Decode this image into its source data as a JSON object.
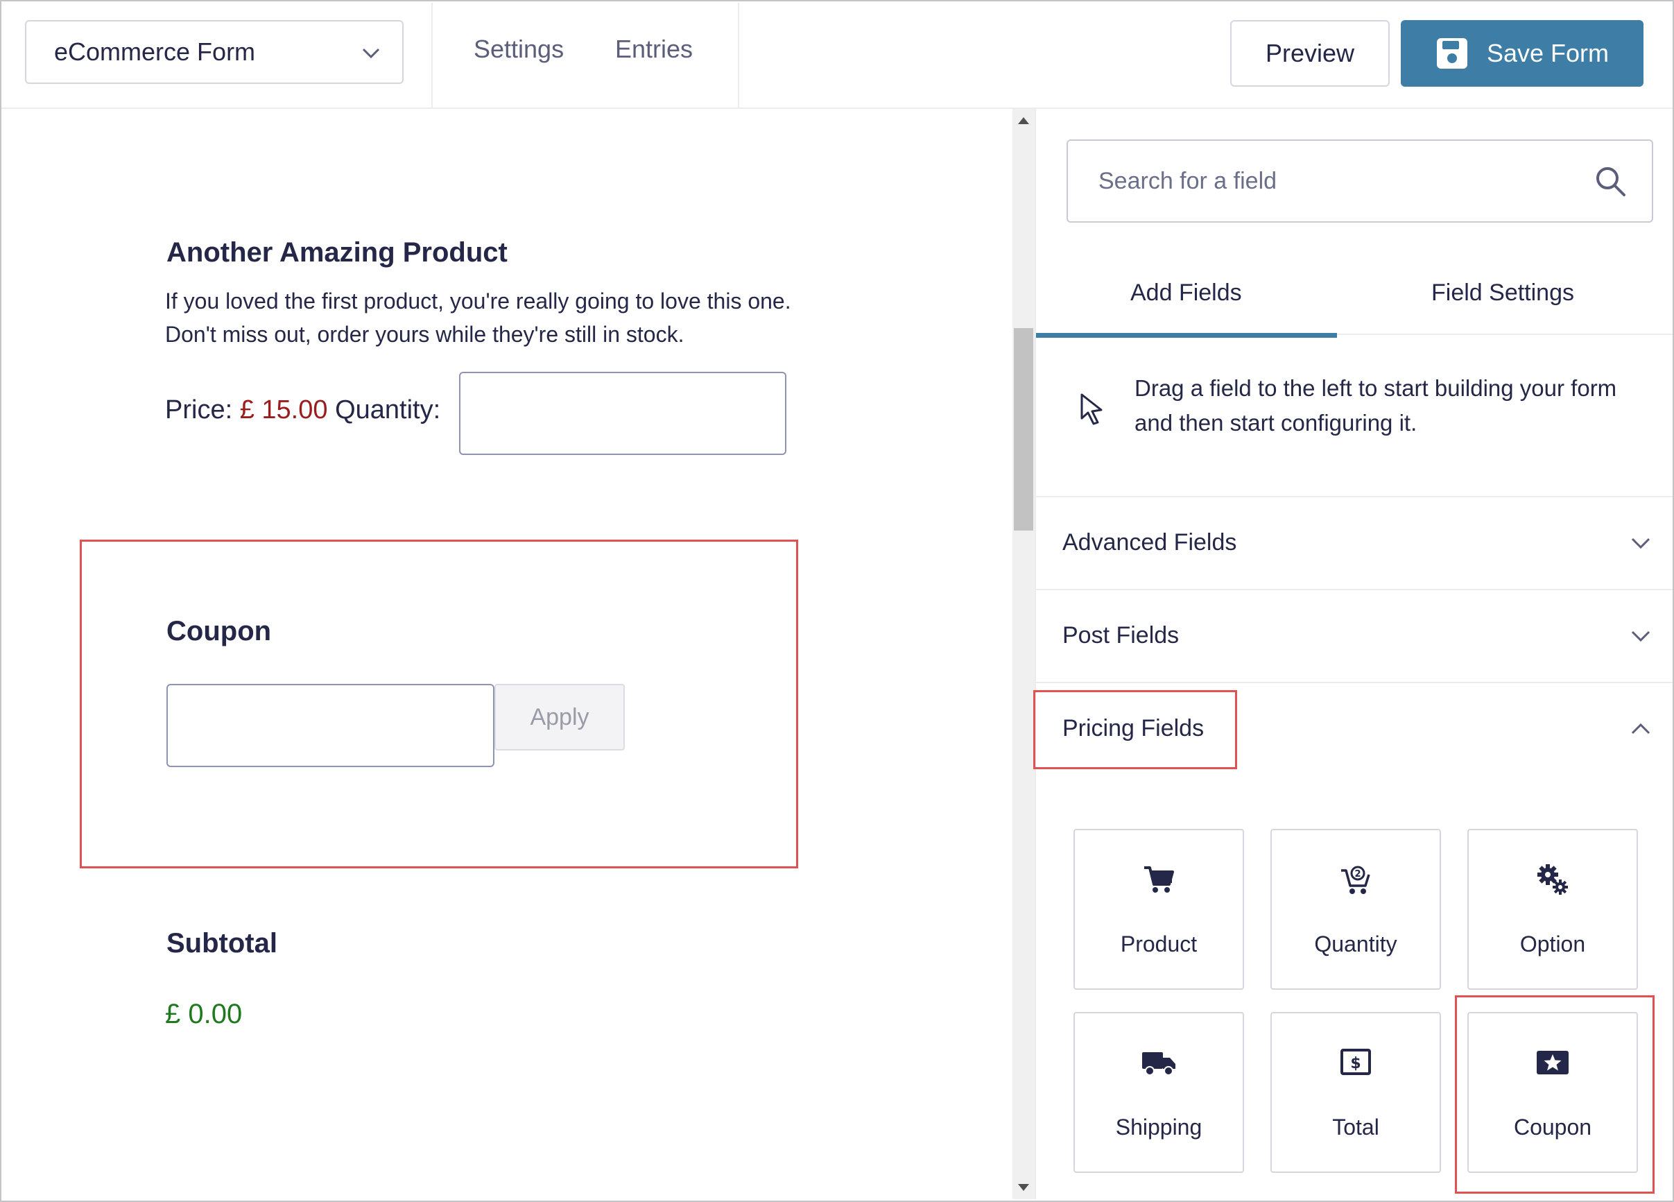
{
  "header": {
    "form_name": "eCommerce Form",
    "nav": [
      "Settings",
      "Entries"
    ],
    "preview_label": "Preview",
    "save_label": "Save Form"
  },
  "canvas": {
    "product": {
      "title": "Another Amazing Product",
      "description_line1": "If you loved the first product, you're really going to love this one.",
      "description_line2": "Don't miss out, order yours while they're still in stock.",
      "price_label": "Price:",
      "price_value": "£ 15.00",
      "quantity_label": "Quantity:"
    },
    "coupon": {
      "title": "Coupon",
      "apply_label": "Apply"
    },
    "subtotal": {
      "title": "Subtotal",
      "value": "£ 0.00"
    }
  },
  "sidebar": {
    "search_placeholder": "Search for a field",
    "tabs": [
      "Add Fields",
      "Field Settings"
    ],
    "active_tab": "Add Fields",
    "hint": "Drag a field to the left to start building your form and then start configuring it.",
    "sections": [
      {
        "label": "Advanced Fields",
        "expanded": false
      },
      {
        "label": "Post Fields",
        "expanded": false
      },
      {
        "label": "Pricing Fields",
        "expanded": true
      }
    ],
    "pricing_fields": [
      {
        "label": "Product",
        "icon": "cart-icon"
      },
      {
        "label": "Quantity",
        "icon": "cart-quantity-icon"
      },
      {
        "label": "Option",
        "icon": "gears-icon"
      },
      {
        "label": "Shipping",
        "icon": "truck-icon"
      },
      {
        "label": "Total",
        "icon": "dollar-box-icon"
      },
      {
        "label": "Coupon",
        "icon": "coupon-star-icon"
      }
    ]
  },
  "colors": {
    "accent": "#3e7da6",
    "highlight": "#e05252",
    "price": "#9b1c1c",
    "subtotal": "#1f7a1f"
  }
}
